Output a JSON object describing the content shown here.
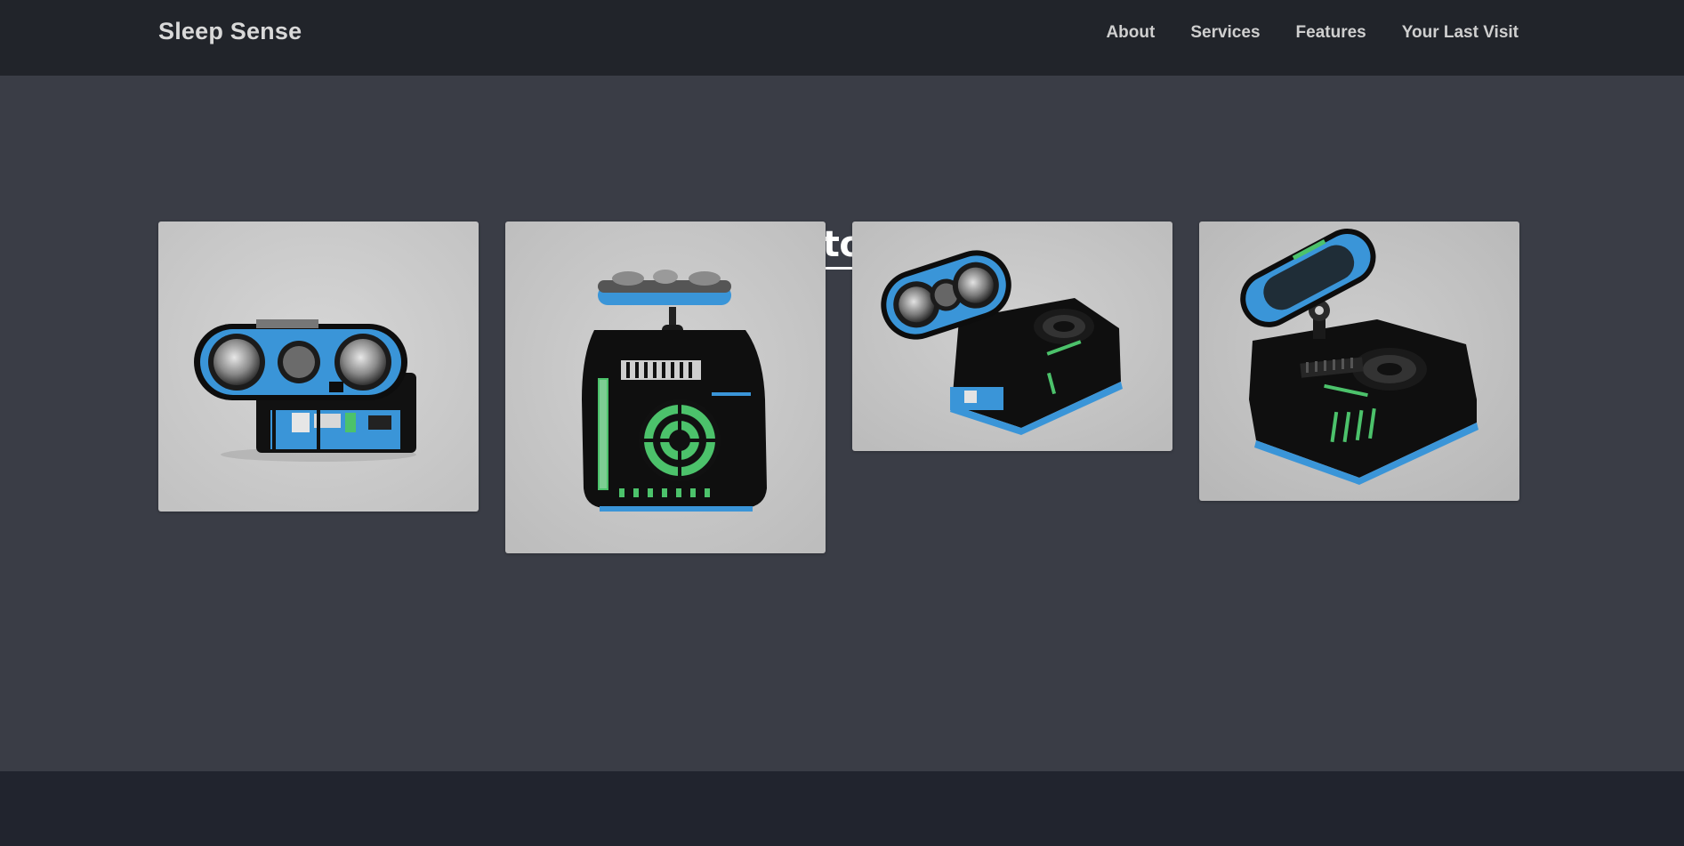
{
  "navbar": {
    "brand": "Sleep Sense",
    "links": [
      {
        "label": "About"
      },
      {
        "label": "Services"
      },
      {
        "label": "Features"
      },
      {
        "label": "Your Last Visit"
      }
    ]
  },
  "prototype_section": {
    "title": "Our 3-D Prototype Model",
    "gallery": [
      {
        "view": "front"
      },
      {
        "view": "top"
      },
      {
        "view": "angled-left"
      },
      {
        "view": "angled-right"
      }
    ]
  },
  "colors": {
    "navbar_bg": "#21242a",
    "page_bg": "#3a3d46",
    "footer_bg": "#21242e",
    "model_accent": "#3a95d8",
    "model_body": "#111111",
    "model_highlight": "#4cc26b",
    "photo_bg": "#cccccc"
  }
}
